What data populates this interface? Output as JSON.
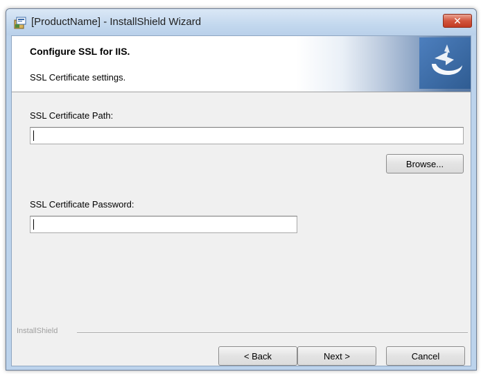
{
  "window": {
    "title": "[ProductName] - InstallShield Wizard",
    "close_label": "✕"
  },
  "banner": {
    "title": "Configure SSL for IIS.",
    "subtitle": "SSL Certificate settings."
  },
  "form": {
    "cert_path": {
      "label": "SSL Certificate Path:",
      "value": ""
    },
    "browse_label": "Browse...",
    "cert_password": {
      "label": "SSL Certificate Password:",
      "value": ""
    }
  },
  "footer": {
    "brand": "InstallShield",
    "back_label": "< Back",
    "next_label": "Next >",
    "cancel_label": "Cancel"
  },
  "colors": {
    "title_bar": "#c3d8ee",
    "close_button": "#c23b22",
    "banner_accent": "#3e6ea8",
    "dialog_body": "#f0f0f0"
  },
  "icons": {
    "title": "installer-package-icon",
    "banner": "installshield-logo-icon"
  }
}
